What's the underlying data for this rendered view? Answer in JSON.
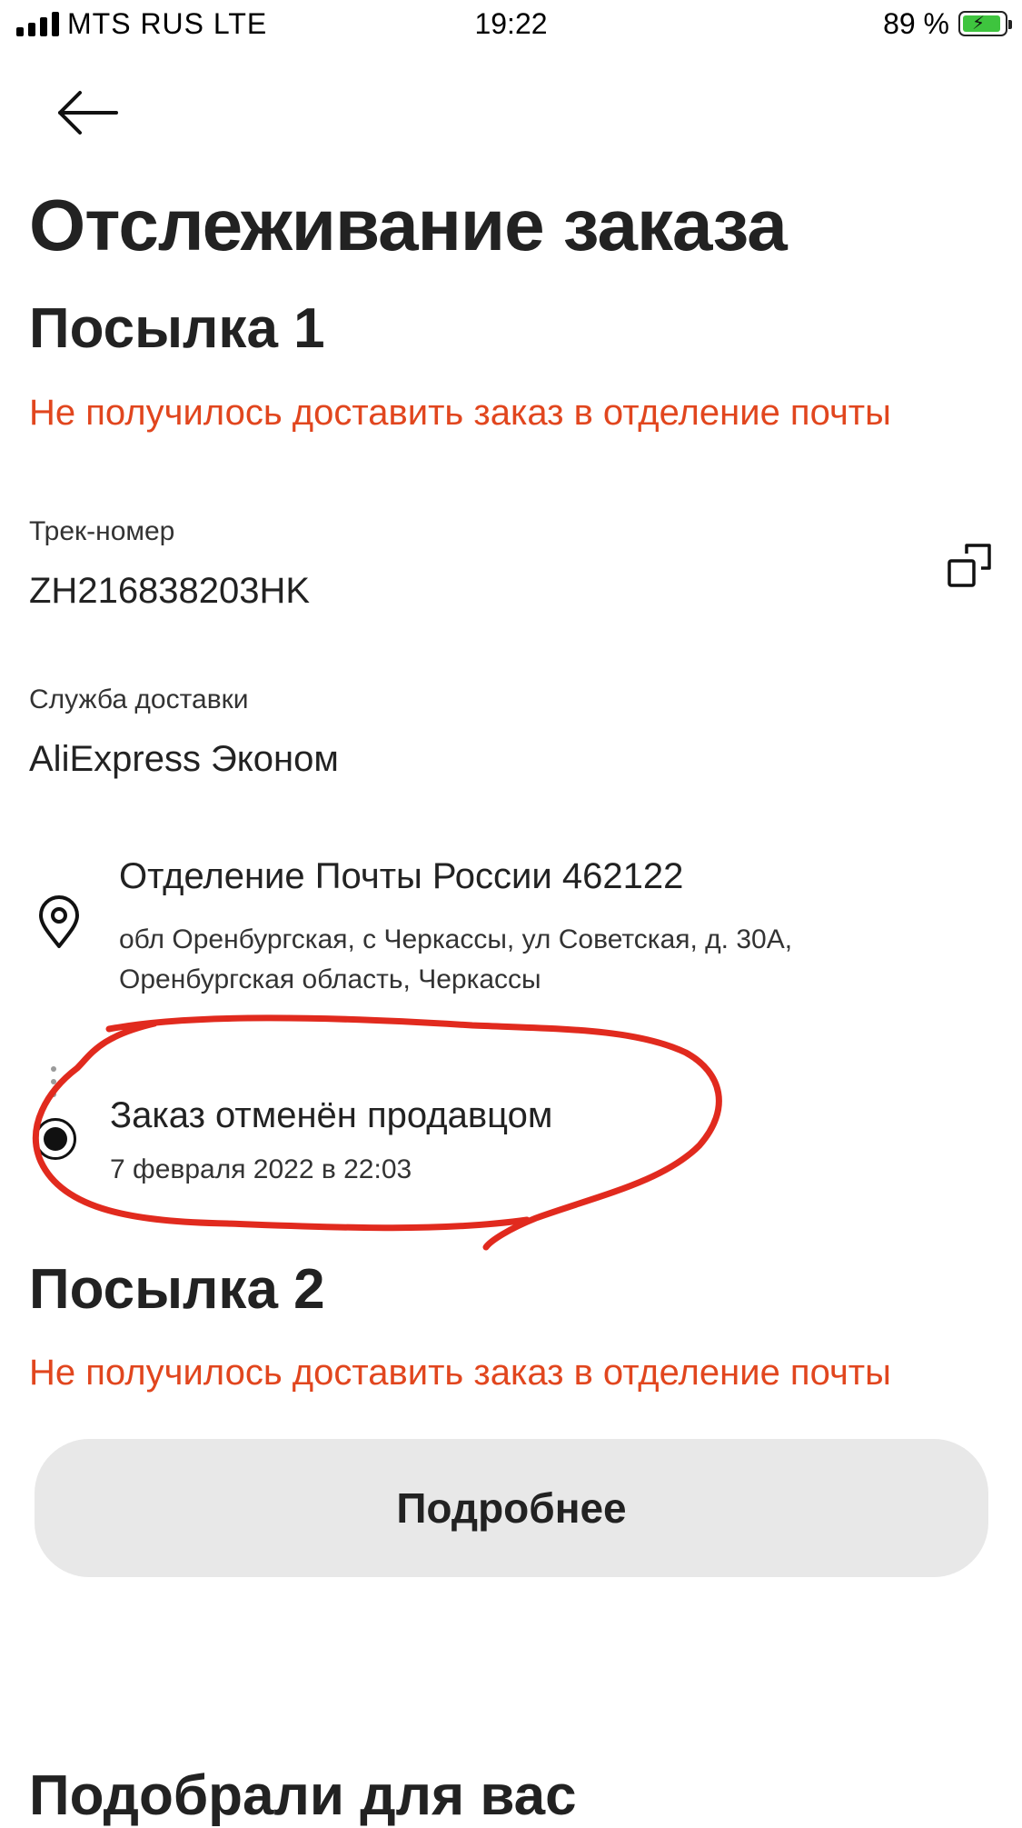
{
  "status_bar": {
    "carrier": "MTS RUS LTE",
    "time": "19:22",
    "battery_percent": "89 %",
    "battery_level": 0.89
  },
  "header": {
    "title": "Отслеживание заказа"
  },
  "parcel1": {
    "title": "Посылка 1",
    "status": "Не получилось доставить заказ в отделение почты",
    "tracking_label": "Трек-номер",
    "tracking_number": "ZH216838203HK",
    "service_label": "Служба доставки",
    "service_name": "AliExpress Эконом",
    "office_title": "Отделение Почты России 462122",
    "office_address": "обл Оренбургская, с Черкассы, ул Советская, д. 30А, Оренбургская область, Черкассы",
    "event_title": "Заказ отменён продавцом",
    "event_date": "7 февраля 2022 в 22:03"
  },
  "parcel2": {
    "title": "Посылка 2",
    "status": "Не получилось доставить заказ в отделение почты"
  },
  "details_button": "Подробнее",
  "recommendations_title": "Подобрали для вас",
  "colors": {
    "warning": "#e1461e",
    "annotation": "#e12a1e",
    "button_bg": "#e8e8e8",
    "text": "#222222"
  }
}
